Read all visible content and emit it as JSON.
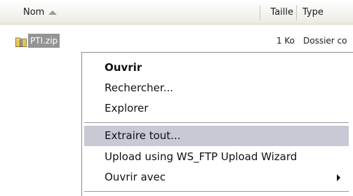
{
  "columns": {
    "name": "Nom",
    "size": "Taille",
    "type": "Type"
  },
  "file": {
    "name": "PTI.zip",
    "size": "1 Ko",
    "type": "Dossier co"
  },
  "menu": {
    "items": [
      {
        "label": "Ouvrir",
        "default": true
      },
      {
        "label": "Rechercher..."
      },
      {
        "label": "Explorer"
      },
      {
        "label": "Extraire tout...",
        "highlighted": true
      },
      {
        "label": "Upload using WS_FTP Upload Wizard"
      },
      {
        "label": "Ouvrir avec",
        "submenu": true
      }
    ]
  },
  "colors": {
    "highlight": "#c9c9d6",
    "selected_file": "#949494"
  }
}
